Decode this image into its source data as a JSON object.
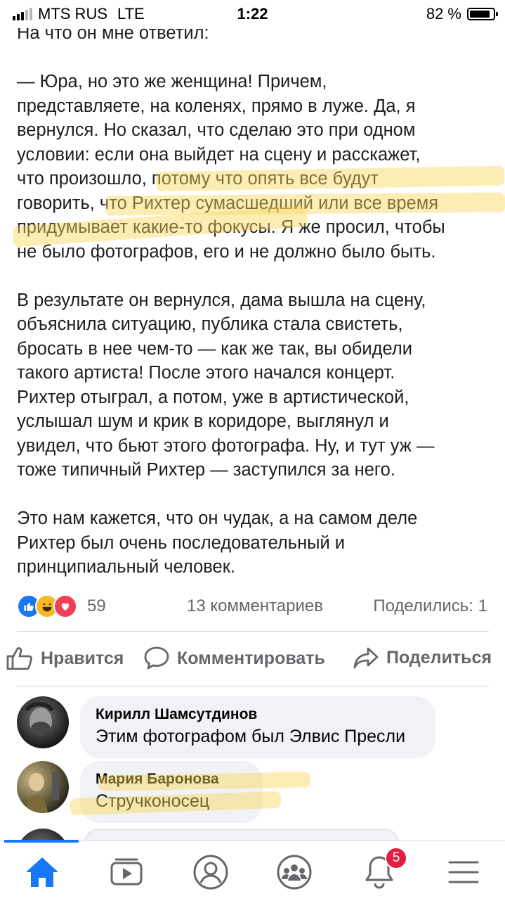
{
  "status_bar": {
    "carrier": "MTS RUS",
    "network": "LTE",
    "time": "1:22",
    "battery": "82 %"
  },
  "article": {
    "lines": [
      "На что он мне ответил:",
      "",
      "— Юра, но это же женщина! Причем,",
      "представляете, на коленях, прямо в луже. Да, я",
      "вернулся. Но сказал, что сделаю это при одном",
      "условии: если она выйдет на сцену и расскажет,",
      "что произошло, потому что опять все будут",
      "говорить, что Рихтер сумасшедший или все время",
      "придумывает какие-то фокусы. Я же просил, чтобы",
      "не было фотографов, его и не должно было быть.",
      "",
      "В результате он вернулся, дама вышла на сцену,",
      "объяснила ситуацию, публика стала свистеть,",
      "бросать в нее чем-то — как же так, вы обидели",
      "такого артиста! После этого начался концерт.",
      "Рихтер отыграл, а потом, уже в артистической,",
      "услышал шум и крик в коридоре, выглянул и",
      "увидел, что бьют этого фотографа. Ну, и тут уж —",
      "тоже типичный Рихтер — заступился за него.",
      "",
      "Это нам кажется, что он чудак, а на самом деле",
      "Рихтер был очень последовательный и",
      "принципиальный человек."
    ]
  },
  "reactions": {
    "count": "59",
    "comments": "13 комментариев",
    "shares": "Поделились: 1"
  },
  "actions": {
    "like": "Нравится",
    "comment": "Комментировать",
    "share": "Поделиться"
  },
  "comments": [
    {
      "name": "Кирилл Шамсутдинов",
      "text": "Этим фотографом был Элвис Пресли"
    },
    {
      "name": "Мария Баронова",
      "text": "Стручконосец"
    }
  ],
  "tabbar": {
    "notifications_badge": "5"
  },
  "colors": {
    "accent": "#1877f2",
    "highlight": "#fad65a",
    "badge": "#e41e3f"
  }
}
